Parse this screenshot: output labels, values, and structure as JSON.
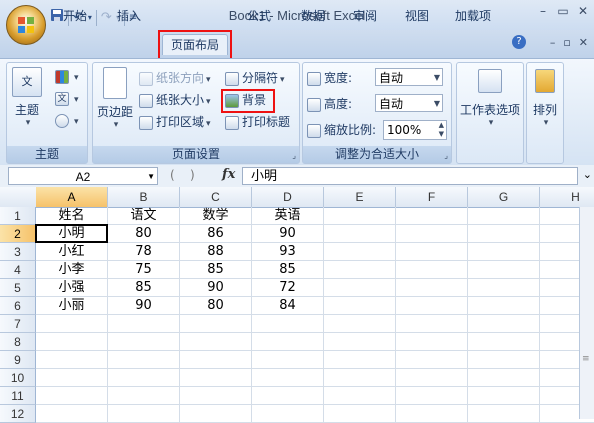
{
  "window": {
    "title": "Book1 - Microsoft Excel"
  },
  "qat": {
    "save_icon": "save-icon",
    "undo_icon": "undo-icon",
    "redo_icon": "redo-icon"
  },
  "tabs": [
    {
      "label": "开始"
    },
    {
      "label": "插入"
    },
    {
      "label": "页面布局"
    },
    {
      "label": "公式"
    },
    {
      "label": "数据"
    },
    {
      "label": "审阅"
    },
    {
      "label": "视图"
    },
    {
      "label": "加载项"
    }
  ],
  "ribbon": {
    "themes": {
      "label": "主题",
      "group_label": "主题"
    },
    "page_setup": {
      "group_label": "页面设置",
      "margins": "页边距",
      "orientation": "纸张方向",
      "size": "纸张大小",
      "print_area": "打印区域",
      "breaks": "分隔符",
      "background": "背景",
      "print_titles": "打印标题"
    },
    "scale": {
      "group_label": "调整为合适大小",
      "width_label": "宽度:",
      "width_value": "自动",
      "height_label": "高度:",
      "height_value": "自动",
      "scale_label": "缩放比例:",
      "scale_value": "100%"
    },
    "sheet_options": {
      "label": "工作表选项"
    },
    "arrange": {
      "label": "排列"
    }
  },
  "formula_bar": {
    "name_box": "A2",
    "fx": "fx",
    "content": "小明"
  },
  "sheet": {
    "columns": [
      "A",
      "B",
      "C",
      "D",
      "E",
      "F",
      "G",
      "H"
    ],
    "rows": [
      "1",
      "2",
      "3",
      "4",
      "5",
      "6",
      "7",
      "8",
      "9",
      "10",
      "11",
      "12"
    ],
    "cells": [
      [
        "姓名",
        "语文",
        "数学",
        "英语"
      ],
      [
        "小明",
        "80",
        "86",
        "90"
      ],
      [
        "小红",
        "78",
        "88",
        "93"
      ],
      [
        "小李",
        "75",
        "85",
        "85"
      ],
      [
        "小强",
        "85",
        "90",
        "72"
      ],
      [
        "小丽",
        "90",
        "80",
        "84"
      ]
    ],
    "active_cell": "A2"
  }
}
